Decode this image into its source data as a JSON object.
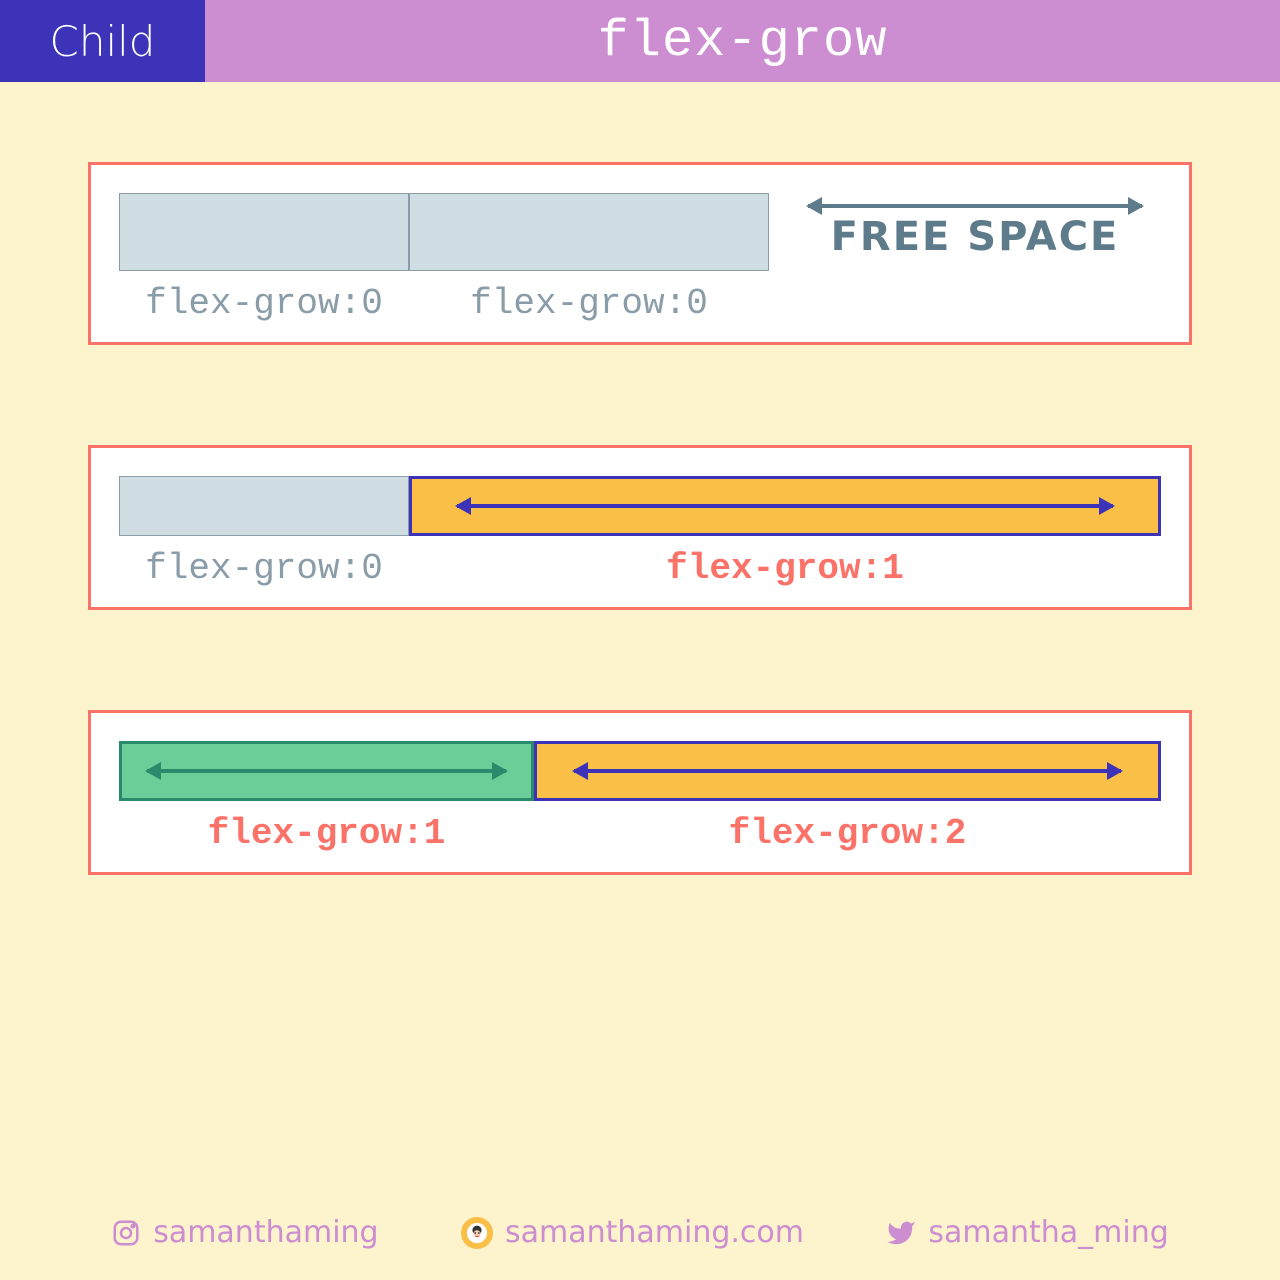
{
  "header": {
    "badge": "Child",
    "title": "flex-grow"
  },
  "example1": {
    "box1_label": "flex-grow:0",
    "box2_label": "flex-grow:0",
    "free_space_label": "FREE SPACE"
  },
  "example2": {
    "box1_label": "flex-grow:0",
    "box2_label": "flex-grow:1"
  },
  "example3": {
    "box1_label": "flex-grow:1",
    "box2_label": "flex-grow:2"
  },
  "footer": {
    "instagram": "samanthaming",
    "website": "samanthaming.com",
    "twitter": "samantha_ming"
  }
}
